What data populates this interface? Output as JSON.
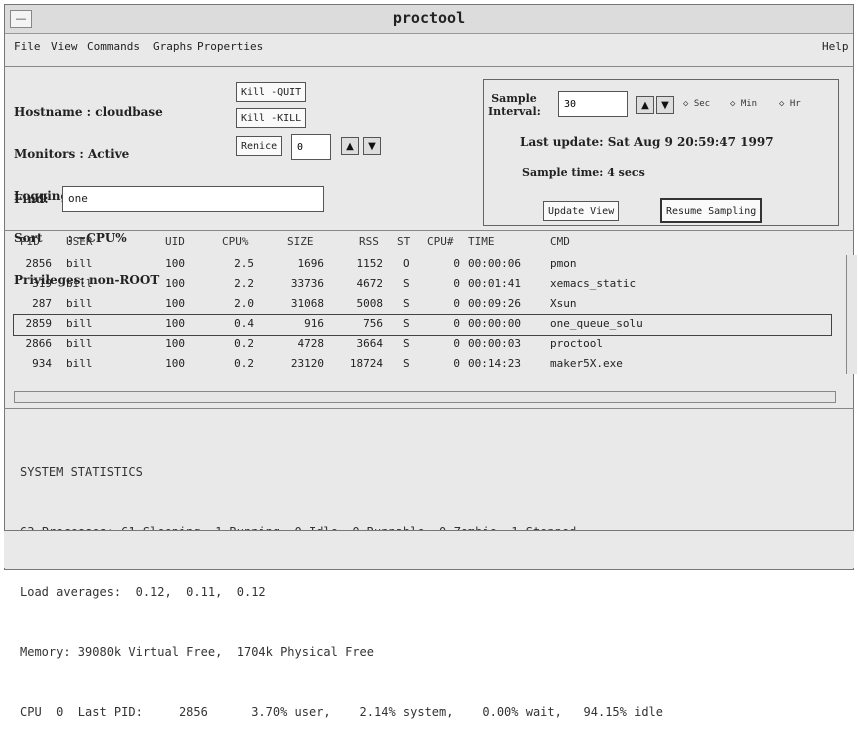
{
  "window": {
    "title": "proctool",
    "close_button": "—"
  },
  "menu": {
    "items": [
      "File",
      "View",
      "Commands",
      "Graphs",
      "Properties"
    ],
    "help": "Help"
  },
  "info": {
    "hostname": "Hostname : cloudbase",
    "monitors": "Monitors : Active",
    "logging": "Logging   : Off",
    "sort": "Sort      : ~CPU%",
    "privileges": "Privileges: non-ROOT"
  },
  "buttons": {
    "kill_quit": "Kill -QUIT",
    "kill_kill": "Kill -KILL",
    "renice": "Renice",
    "renice_value": "0",
    "update_view": "Update View",
    "resume_sampling": "Resume Sampling"
  },
  "find": {
    "label": "Find:",
    "value": "one"
  },
  "sample": {
    "label": "Sample\nInterval:",
    "value": "30",
    "radios": [
      "Sec",
      "Min",
      "Hr"
    ],
    "last_update": "Last update: Sat Aug  9 20:59:47 1997",
    "sample_time": "Sample time: 4 secs"
  },
  "arrows": {
    "up": "▲",
    "down": "▼"
  },
  "table": {
    "headers": [
      "PID",
      "USER",
      "UID",
      "CPU%",
      "SIZE",
      "RSS",
      "ST",
      "CPU#",
      "TIME",
      "CMD"
    ],
    "rows": [
      [
        "2856",
        "bill",
        "100",
        "2.5",
        "1696",
        "1152",
        "O",
        "0",
        "00:00:06",
        "pmon"
      ],
      [
        "319",
        "bill",
        "100",
        "2.2",
        "33736",
        "4672",
        "S",
        "0",
        "00:01:41",
        "xemacs_static"
      ],
      [
        "287",
        "bill",
        "100",
        "2.0",
        "31068",
        "5008",
        "S",
        "0",
        "00:09:26",
        "Xsun"
      ],
      [
        "2859",
        "bill",
        "100",
        "0.4",
        "916",
        "756",
        "S",
        "0",
        "00:00:00",
        "one_queue_solu"
      ],
      [
        "2866",
        "bill",
        "100",
        "0.2",
        "4728",
        "3664",
        "S",
        "0",
        "00:00:03",
        "proctool"
      ],
      [
        "934",
        "bill",
        "100",
        "0.2",
        "23120",
        "18724",
        "S",
        "0",
        "00:14:23",
        "maker5X.exe"
      ]
    ]
  },
  "stats": {
    "title": "SYSTEM STATISTICS",
    "processes": "63 Processes: 61 Sleeping, 1 Running, 0 Idle, 0 Runnable, 0 Zombie, 1 Stopped",
    "load": "Load averages:  0.12,  0.11,  0.12",
    "memory": "Memory: 39080k Virtual Free,  1704k Physical Free",
    "cpu": "CPU  0  Last PID:     2856      3.70% user,    2.14% system,    0.00% wait,   94.15% idle"
  }
}
